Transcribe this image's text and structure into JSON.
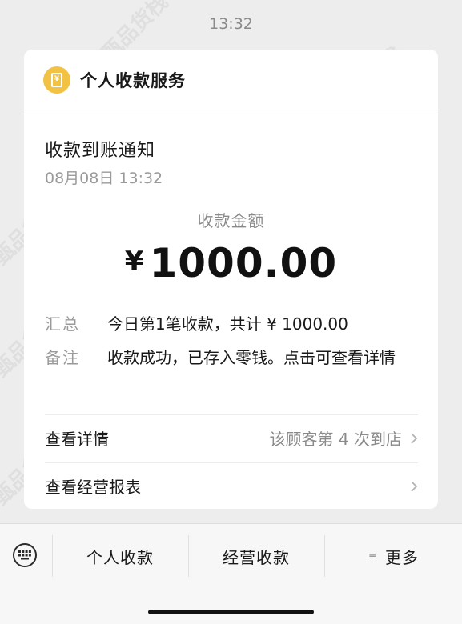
{
  "timestamp": "13:32",
  "card": {
    "service_name": "个人收款服务",
    "title": "收款到账通知",
    "date": "08月08日 13:32",
    "amount_label": "收款金额",
    "currency_symbol": "¥",
    "amount": "1000.00",
    "summary_key": "汇总",
    "summary_value": "今日第1笔收款，共计 ¥ 1000.00",
    "note_key": "备注",
    "note_value": "收款成功，已存入零钱。点击可查看详情",
    "details_label": "查看详情",
    "details_value": "该顾客第 4 次到店",
    "report_label": "查看经营报表"
  },
  "bottom_bar": {
    "tab_personal": "个人收款",
    "tab_business": "经营收款",
    "tab_more": "更多"
  },
  "watermark_text": "甄品货栈",
  "colors": {
    "accent_icon": "#f2c242",
    "background": "#ededed",
    "card": "#ffffff"
  }
}
